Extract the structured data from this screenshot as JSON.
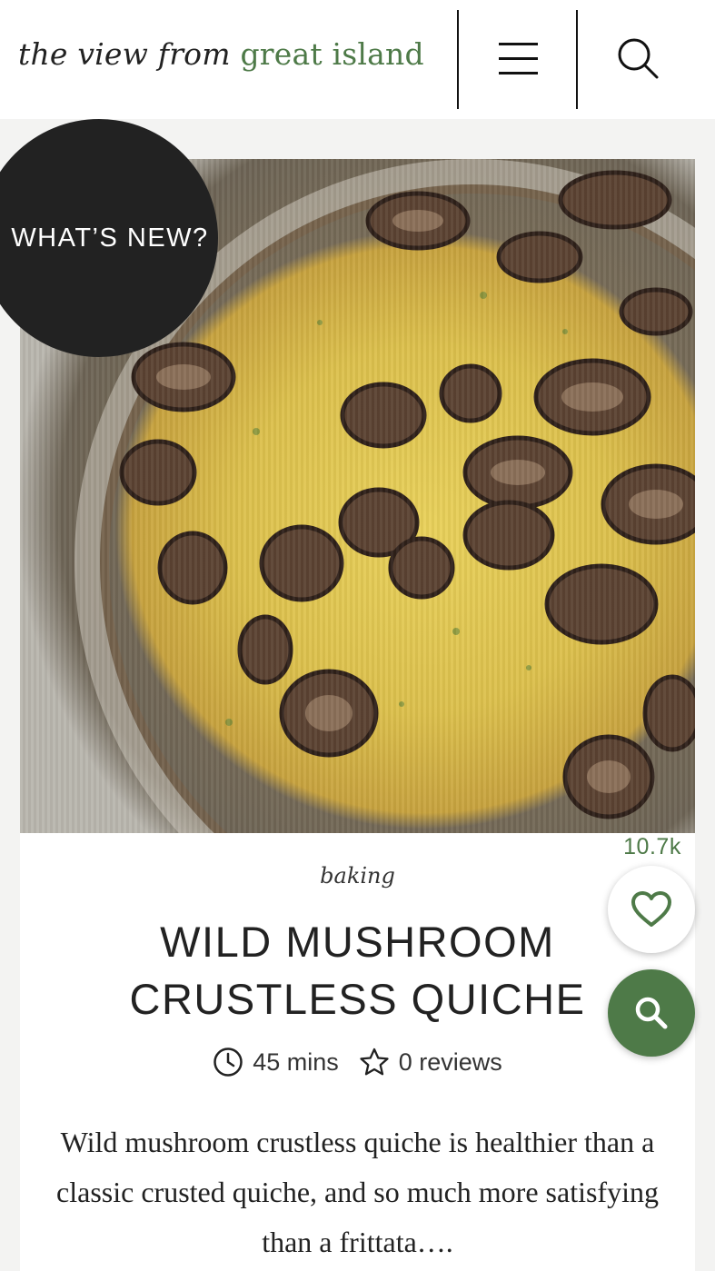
{
  "header": {
    "logo_part1": "the view from",
    "logo_part2": "great island",
    "menu_icon": "hamburger-menu-icon",
    "search_icon": "search-icon"
  },
  "hero": {
    "image": "mushroom-quiche-photo",
    "badge_label": "WHAT’S NEW?"
  },
  "recipe": {
    "category": "baking",
    "title": "WILD MUSHROOM CRUSTLESS QUICHE",
    "time": "45 mins",
    "reviews": "0 reviews",
    "description": "Wild mushroom crustless quiche is healthier than a classic crusted quiche, and so much more satisfying than a frittata…."
  },
  "floating": {
    "favorites_count": "10.7k",
    "heart_icon": "heart-icon",
    "search_icon": "search-icon"
  },
  "colors": {
    "brand_green": "#4e7a48",
    "badge_dark": "#222222",
    "page_bg": "#f3f3f2"
  }
}
